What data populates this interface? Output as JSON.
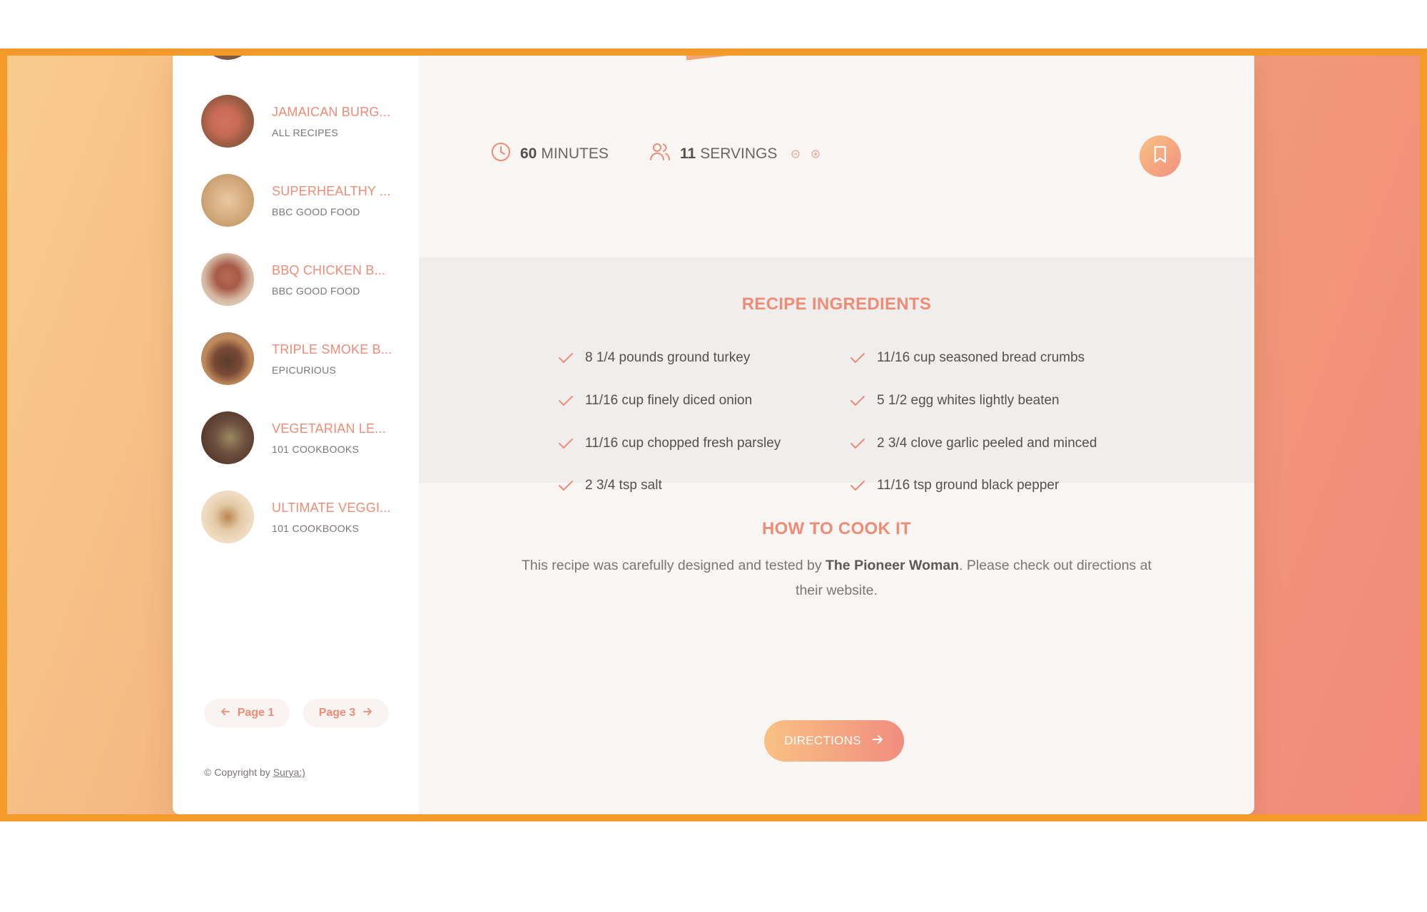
{
  "sidebar": {
    "items": [
      {
        "title": "JAMAICAN BURG...",
        "publisher": "ALL RECIPES"
      },
      {
        "title": "SUPERHEALTHY ...",
        "publisher": "BBC GOOD FOOD"
      },
      {
        "title": "BBQ CHICKEN B...",
        "publisher": "BBC GOOD FOOD"
      },
      {
        "title": "TRIPLE SMOKE B...",
        "publisher": "EPICURIOUS"
      },
      {
        "title": "VEGETARIAN LE...",
        "publisher": "101 COOKBOOKS"
      },
      {
        "title": "ULTIMATE VEGGI...",
        "publisher": "101 COOKBOOKS"
      }
    ],
    "pagination": {
      "prev_label": "Page 1",
      "next_label": "Page 3"
    },
    "copyright": {
      "prefix": "© Copyright by ",
      "author": "Surya:)"
    }
  },
  "recipe": {
    "time": {
      "value": "60",
      "unit": "MINUTES"
    },
    "servings": {
      "value": "11",
      "unit": "SERVINGS"
    },
    "ingredients_title": "RECIPE INGREDIENTS",
    "ingredients": [
      "8 1/4 pounds ground turkey",
      "11/16 cup seasoned bread crumbs",
      "11/16 cup finely diced onion",
      "5 1/2 egg whites lightly beaten",
      "11/16 cup chopped fresh parsley",
      "2 3/4 clove garlic peeled and minced",
      "2 3/4 tsp salt",
      "11/16 tsp ground black pepper"
    ],
    "howto_title": "HOW TO COOK IT",
    "howto": {
      "prefix": "This recipe was carefully designed and tested by ",
      "publisher": "The Pioneer Woman",
      "suffix": ". Please check out directions at their website."
    },
    "directions_label": "DIRECTIONS"
  },
  "icons": {
    "time": "clock-icon",
    "servings": "users-icon",
    "decrease": "minus-circle-icon",
    "increase": "plus-circle-icon",
    "bookmark": "bookmark-icon",
    "check": "check-icon",
    "arrow_left": "arrow-left-icon",
    "arrow_right": "arrow-right-icon"
  },
  "colors": {
    "accent": "#ee8c75",
    "frame_border": "#f39a2a",
    "gradient_start": "#f8c182",
    "gradient_end": "#f18d80"
  }
}
